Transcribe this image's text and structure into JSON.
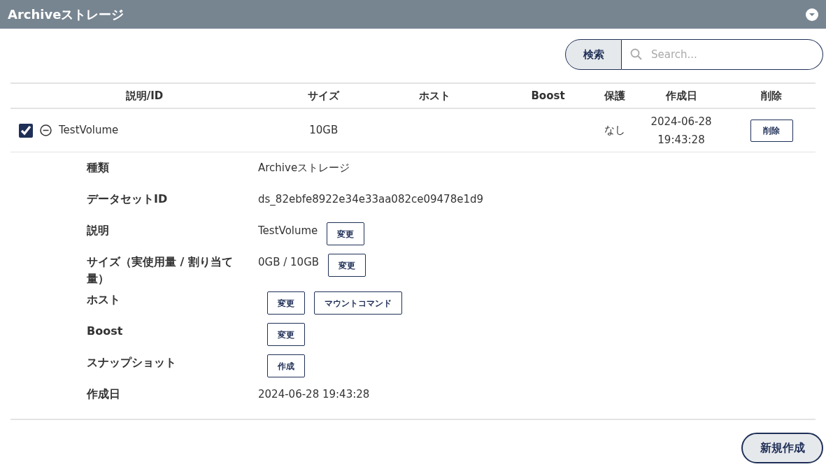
{
  "panel": {
    "title": "Archiveストレージ"
  },
  "search": {
    "button": "検索",
    "placeholder": "Search..."
  },
  "table": {
    "columns": [
      "説明/ID",
      "サイズ",
      "ホスト",
      "Boost",
      "保護",
      "作成日",
      "削除"
    ],
    "rows": [
      {
        "checked": true,
        "expanded": true,
        "name": "TestVolume",
        "size": "10GB",
        "protection": "なし",
        "created": [
          "2024-06-28",
          "19:43:28"
        ],
        "delete": "削除",
        "details": [
          {
            "label": "種類",
            "value": "Archiveストレージ"
          },
          {
            "label": "データセットID",
            "value": "ds_82ebfe8922e34e33aa082ce09478e1d9"
          },
          {
            "label": "説明",
            "value": "TestVolume",
            "buttons": [
              "変更"
            ]
          },
          {
            "label": "サイズ（実使用量 / 割り当て量）",
            "value": "0GB / 10GB",
            "buttons": [
              "変更"
            ]
          },
          {
            "label": "ホスト",
            "buttons": [
              "変更",
              "マウントコマンド"
            ]
          },
          {
            "label": "Boost",
            "buttons": [
              "変更"
            ]
          },
          {
            "label": "スナップショット",
            "buttons": [
              "作成"
            ]
          },
          {
            "label": "作成日",
            "value": "2024-06-28 19:43:28"
          }
        ]
      }
    ]
  },
  "new_button": "新規作成"
}
